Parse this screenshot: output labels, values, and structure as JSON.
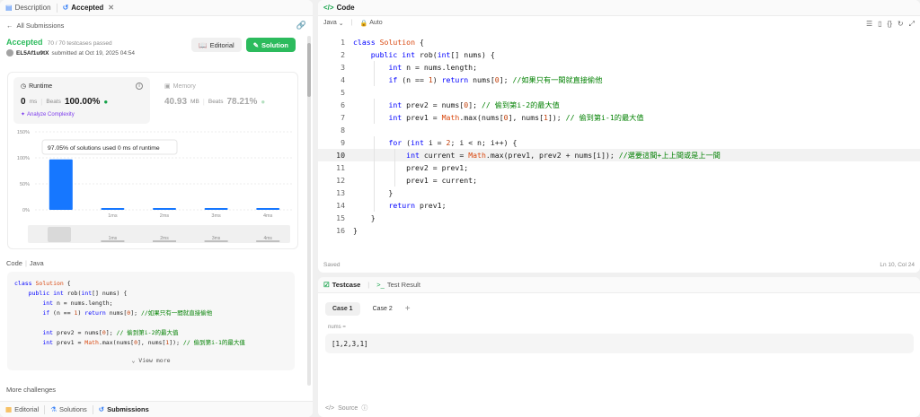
{
  "left_tabs": {
    "description": "Description",
    "accepted": "Accepted"
  },
  "back_link": "All Submissions",
  "result": {
    "status": "Accepted",
    "cases": "70 / 70 testcases passed",
    "user": "EL5Af1u9tX",
    "submitted": "submitted at Oct 19, 2025 04:54",
    "editorial_btn": "Editorial",
    "solution_btn": "Solution"
  },
  "runtime": {
    "title": "Runtime",
    "value": "0",
    "unit": "ms",
    "beats_label": "Beats",
    "beats_value": "100.00%",
    "analyze": "Analyze Complexity"
  },
  "memory": {
    "title": "Memory",
    "value": "40.93",
    "unit": "MB",
    "beats_label": "Beats",
    "beats_value": "78.21%"
  },
  "chart_data": {
    "type": "bar",
    "categories": [
      "0ms",
      "1ms",
      "2ms",
      "3ms",
      "4ms"
    ],
    "x_tick_labels": [
      "",
      "1ms",
      "2ms",
      "3ms",
      "4ms"
    ],
    "values": [
      97.05,
      2,
      1,
      1,
      1
    ],
    "ylim": [
      0,
      150
    ],
    "y_ticks": [
      "150%",
      "100%",
      "50%",
      "0%"
    ],
    "tooltip": "97.05% of solutions used 0 ms of runtime",
    "highlight_index": 0,
    "colors": {
      "bar": "#1677ff"
    }
  },
  "code_section": {
    "label": "Code",
    "lang": "Java",
    "view_more": "View more",
    "lines": [
      "class Solution {",
      "    public int rob(int[] nums) {",
      "        int n = nums.length;",
      "        if (n == 1) return nums[0]; //如果只有一間就直接偷他",
      "",
      "        int prev2 = nums[0]; // 偷到第i-2的最大值",
      "        int prev1 = Math.max(nums[0], nums[1]); // 偷到第i-1的最大值"
    ]
  },
  "more_challenges": "More challenges",
  "bottom_tabs": {
    "editorial": "Editorial",
    "solutions": "Solutions",
    "submissions": "Submissions"
  },
  "code_panel": {
    "title": "Code",
    "language": "Java",
    "autosave": "Auto",
    "saved": "Saved",
    "cursor": "Ln 10, Col 24",
    "lines": [
      "class Solution {",
      "    public int rob(int[] nums) {",
      "        int n = nums.length;",
      "        if (n == 1) return nums[0]; //如果只有一間就直接偷他",
      "",
      "        int prev2 = nums[0]; // 偷到第i-2的最大值",
      "        int prev1 = Math.max(nums[0], nums[1]); // 偷到第i-1的最大值",
      "",
      "        for (int i = 2; i < n; i++) {",
      "            int current = Math.max(prev1, prev2 + nums[i]); //選要這間+上上間或是上一間",
      "            prev2 = prev1;",
      "            prev1 = current;",
      "        }",
      "        return prev1;",
      "    }",
      "}"
    ],
    "current_line": 10
  },
  "testcase": {
    "tab_testcase": "Testcase",
    "tab_result": "Test Result",
    "case1": "Case 1",
    "case2": "Case 2",
    "var_name": "nums =",
    "var_value": "[1,2,3,1]",
    "source": "Source"
  }
}
